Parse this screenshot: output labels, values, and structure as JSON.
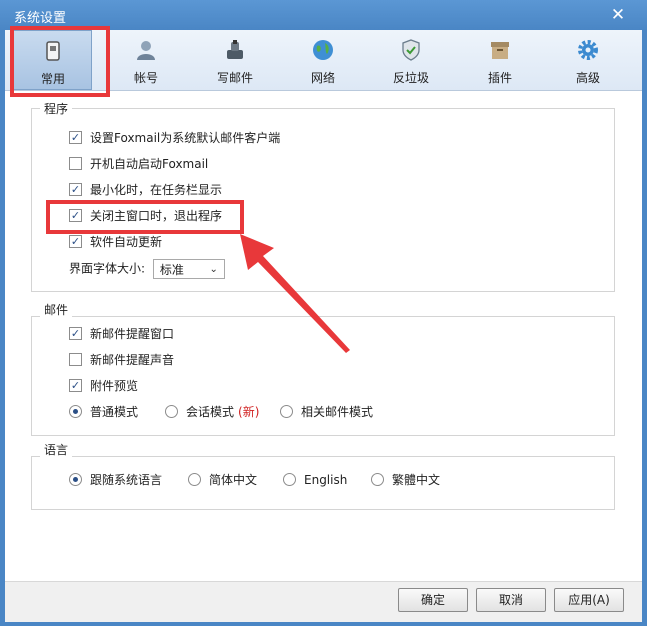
{
  "window": {
    "title": "系统设置",
    "close": "✕"
  },
  "tabs": [
    {
      "label": "常用",
      "icon": "general-icon",
      "active": true
    },
    {
      "label": "帐号",
      "icon": "account-icon"
    },
    {
      "label": "写邮件",
      "icon": "compose-icon"
    },
    {
      "label": "网络",
      "icon": "network-icon"
    },
    {
      "label": "反垃圾",
      "icon": "antispam-icon"
    },
    {
      "label": "插件",
      "icon": "plugin-icon"
    },
    {
      "label": "高级",
      "icon": "advanced-icon"
    }
  ],
  "program": {
    "title": "程序",
    "options": [
      {
        "label": "设置Foxmail为系统默认邮件客户端",
        "checked": true
      },
      {
        "label": "开机自动启动Foxmail",
        "checked": false
      },
      {
        "label": "最小化时，在任务栏显示",
        "checked": true
      },
      {
        "label": "关闭主窗口时，退出程序",
        "checked": true
      },
      {
        "label": "软件自动更新",
        "checked": true
      }
    ],
    "font_size_label": "界面字体大小:",
    "font_size_value": "标准"
  },
  "mail": {
    "title": "邮件",
    "options": [
      {
        "label": "新邮件提醒窗口",
        "checked": true
      },
      {
        "label": "新邮件提醒声音",
        "checked": false
      },
      {
        "label": "附件预览",
        "checked": true
      }
    ],
    "modes": [
      {
        "label": "普通模式",
        "selected": true
      },
      {
        "label": "会话模式",
        "suffix": "(新)",
        "selected": false
      },
      {
        "label": "相关邮件模式",
        "selected": false
      }
    ]
  },
  "language": {
    "title": "语言",
    "options": [
      {
        "label": "跟随系统语言",
        "selected": true
      },
      {
        "label": "简体中文",
        "selected": false
      },
      {
        "label": "English",
        "selected": false
      },
      {
        "label": "繁體中文",
        "selected": false
      }
    ]
  },
  "buttons": {
    "ok": "确定",
    "cancel": "取消",
    "apply": "应用(A)"
  },
  "colors": {
    "annotation": "#e8383a",
    "accent": "#4a86c5"
  }
}
